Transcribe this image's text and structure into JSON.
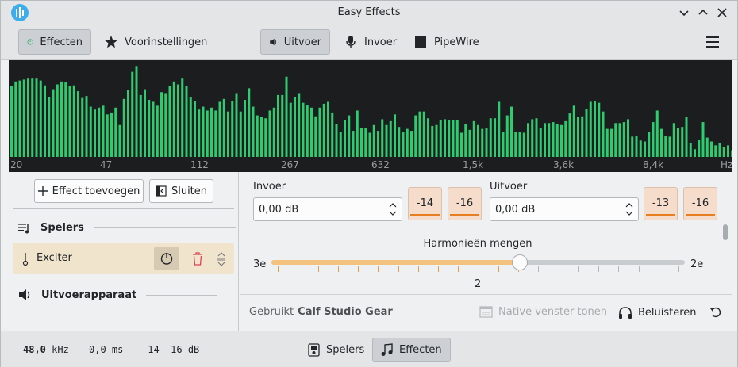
{
  "window": {
    "title": "Easy Effects"
  },
  "toolbar": {
    "effects": "Effecten",
    "presets": "Voorinstellingen",
    "output": "Uitvoer",
    "input": "Invoer",
    "pipewire": "PipeWire"
  },
  "spectrum": {
    "bars": [
      73,
      78,
      79,
      80,
      81,
      81,
      81,
      79,
      74,
      62,
      70,
      75,
      78,
      77,
      73,
      74,
      68,
      61,
      63,
      52,
      49,
      51,
      53,
      44,
      46,
      51,
      33,
      60,
      69,
      88,
      94,
      64,
      70,
      59,
      57,
      53,
      67,
      66,
      73,
      78,
      75,
      81,
      73,
      62,
      58,
      49,
      52,
      48,
      51,
      48,
      57,
      60,
      47,
      58,
      66,
      47,
      59,
      71,
      52,
      43,
      41,
      40,
      48,
      51,
      64,
      64,
      83,
      56,
      62,
      66,
      56,
      54,
      51,
      42,
      51,
      55,
      57,
      46,
      34,
      26,
      38,
      43,
      27,
      48,
      30,
      30,
      25,
      33,
      27,
      39,
      33,
      37,
      44,
      31,
      26,
      29,
      27,
      43,
      47,
      47,
      40,
      32,
      33,
      38,
      39,
      38,
      38,
      38,
      25,
      34,
      28,
      37,
      33,
      29,
      30,
      40,
      40,
      57,
      26,
      43,
      52,
      26,
      26,
      25,
      35,
      39,
      40,
      30,
      35,
      35,
      36,
      34,
      33,
      37,
      45,
      53,
      41,
      42,
      50,
      57,
      58,
      56,
      47,
      29,
      29,
      35,
      35,
      36,
      39,
      21,
      22,
      17,
      16,
      26,
      36,
      48,
      29,
      22,
      21,
      35,
      30,
      31,
      41,
      14,
      8,
      18,
      36,
      20,
      16,
      12,
      14,
      10,
      12,
      7,
      7
    ],
    "bar_color": "#2ecc71",
    "x_labels": [
      "20",
      "47",
      "112",
      "267",
      "632",
      "1,5k",
      "3,6k",
      "8,4k",
      "Hz"
    ]
  },
  "left": {
    "add_effect": "Effect toevoegen",
    "close": "Sluiten",
    "players_section": "Spelers",
    "effect_item": "Exciter",
    "output_device_section": "Uitvoerapparaat"
  },
  "right": {
    "input_label": "Invoer",
    "input_value": "0,00 dB",
    "input_meter_l": "-14",
    "input_meter_r": "-16",
    "output_label": "Uitvoer",
    "output_value": "0,00 dB",
    "output_meter_l": "-13",
    "output_meter_r": "-16",
    "slider_title": "Harmonieën mengen",
    "slider_min_label": "3e",
    "slider_max_label": "2e",
    "slider_value": "2",
    "slider_fraction": 0.6,
    "uses_prefix": "Gebruikt",
    "uses_name": "Calf Studio Gear",
    "native_window": "Native venster tonen",
    "listen": "Beluisteren"
  },
  "status": {
    "sample_rate": "48,0",
    "sample_rate_unit": "kHz",
    "latency": "0,0",
    "latency_unit": "ms",
    "levels": "-14 -16",
    "levels_unit": "dB",
    "players_tab": "Spelers",
    "effects_tab": "Effecten"
  }
}
